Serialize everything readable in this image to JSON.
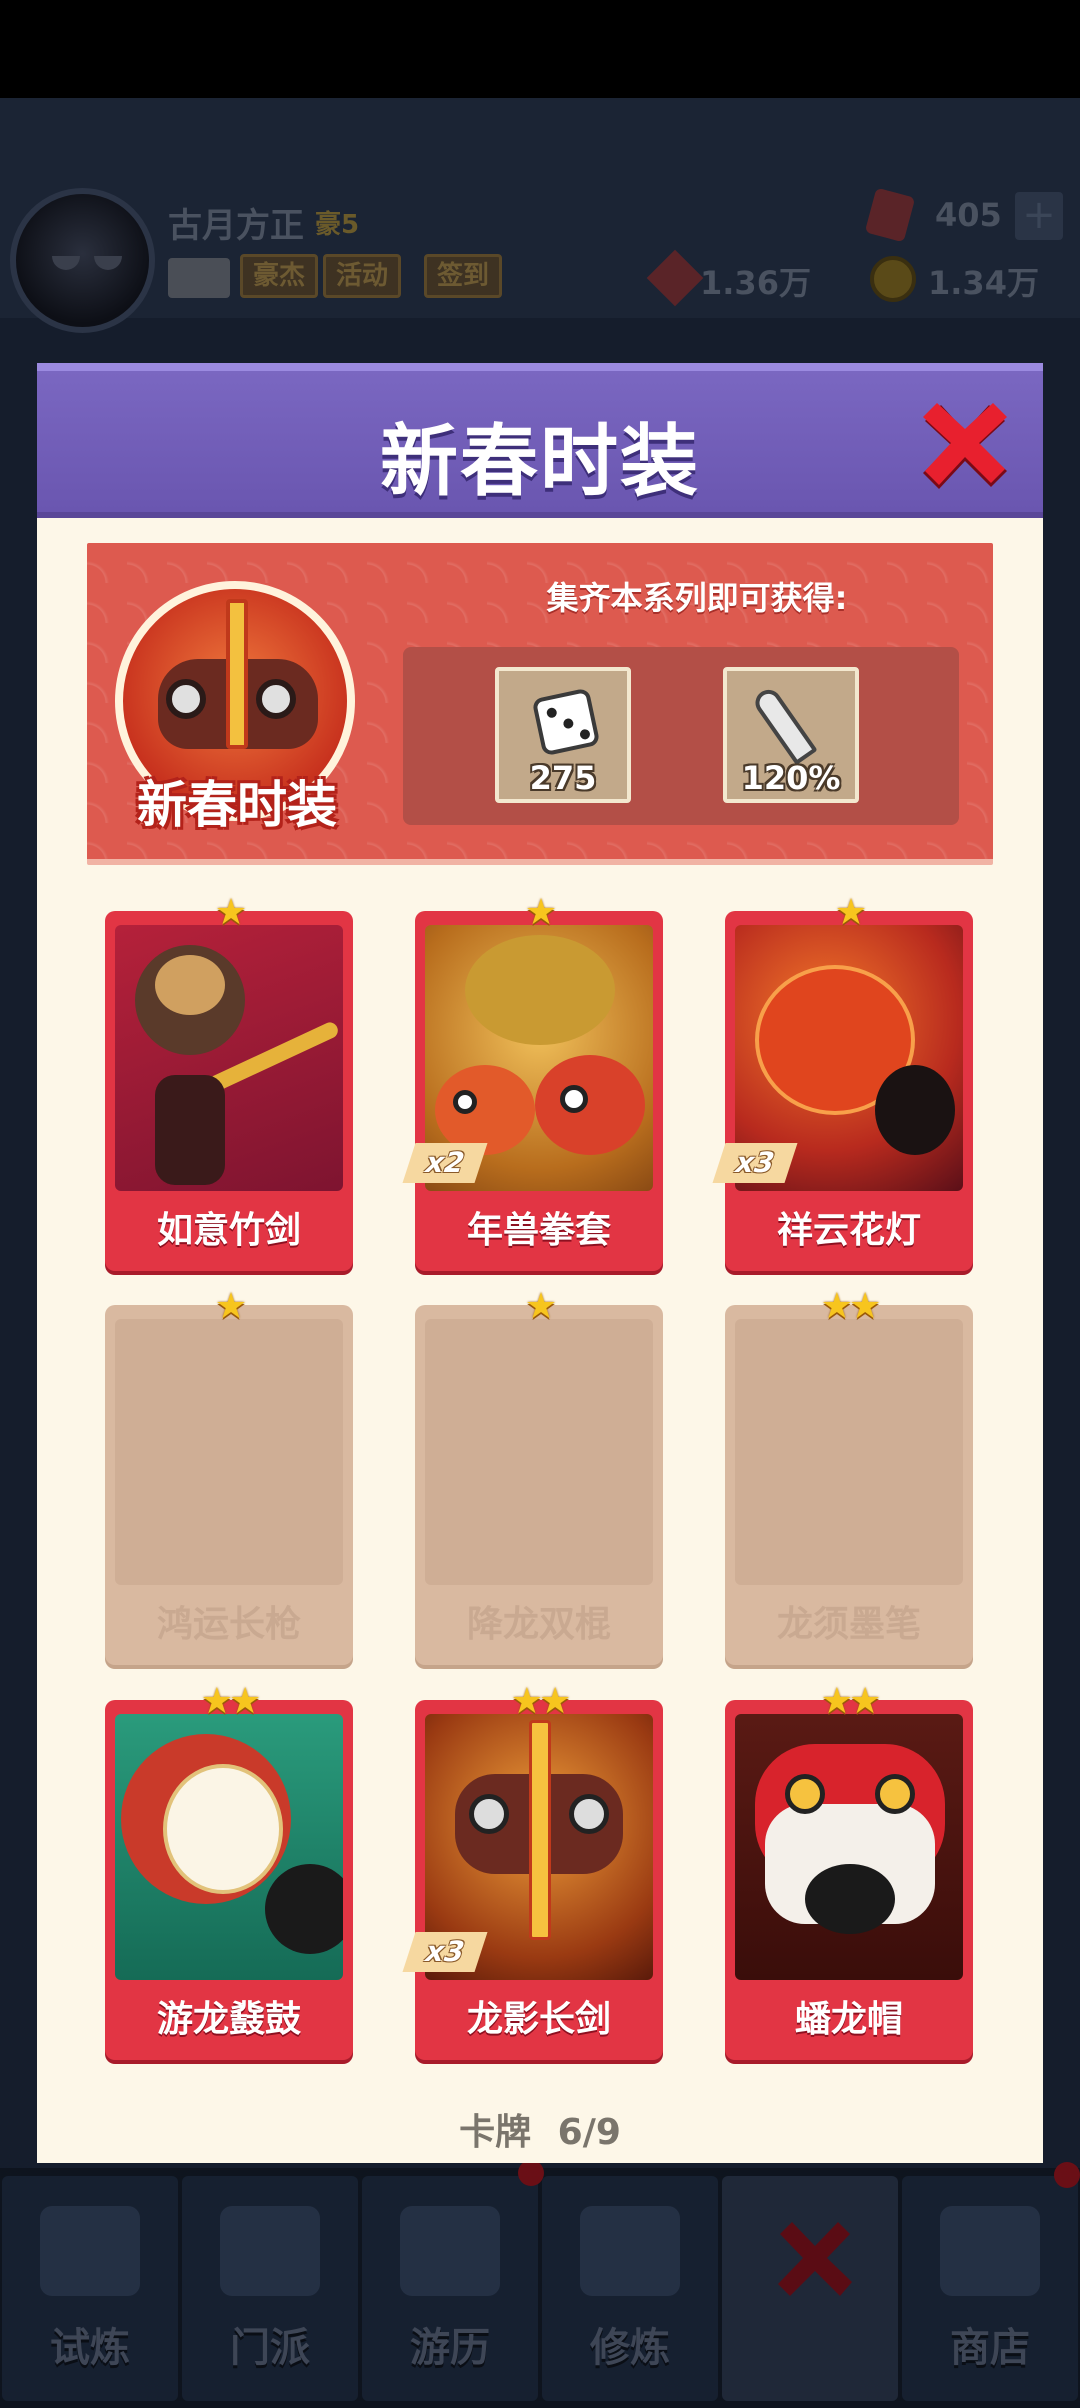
{
  "player": {
    "name": "古月方正",
    "rank": "豪5",
    "buttons": [
      "豪杰",
      "活动",
      "签到"
    ]
  },
  "currency": {
    "gems": "405",
    "tokens": "1.36万",
    "gold": "1.34万"
  },
  "modal": {
    "title": "新春时装",
    "banner": {
      "badge_label": "新春时装",
      "reward_title": "集齐本系列即可获得:",
      "rewards": [
        {
          "icon": "dice-icon",
          "label": "275"
        },
        {
          "icon": "knife-icon",
          "label": "120%"
        }
      ]
    },
    "cards": [
      {
        "name": "如意竹剑",
        "stars": "★",
        "multiplier": "",
        "locked": false
      },
      {
        "name": "年兽拳套",
        "stars": "★",
        "multiplier": "x2",
        "locked": false
      },
      {
        "name": "祥云花灯",
        "stars": "★",
        "multiplier": "x3",
        "locked": false
      },
      {
        "name": "鸿运长枪",
        "stars": "★",
        "multiplier": "",
        "locked": true
      },
      {
        "name": "降龙双棍",
        "stars": "★",
        "multiplier": "",
        "locked": true
      },
      {
        "name": "龙须墨笔",
        "stars": "★★",
        "multiplier": "",
        "locked": true
      },
      {
        "name": "游龙鼗鼓",
        "stars": "★★",
        "multiplier": "",
        "locked": false
      },
      {
        "name": "龙影长剑",
        "stars": "★★",
        "multiplier": "x3",
        "locked": false
      },
      {
        "name": "蟠龙帽",
        "stars": "★★",
        "multiplier": "",
        "locked": false
      }
    ],
    "pager_label": "卡牌",
    "pager_value": "6/9"
  },
  "bottom_nav": [
    {
      "label": "试炼"
    },
    {
      "label": "门派"
    },
    {
      "label": "游历"
    },
    {
      "label": "修炼"
    },
    {
      "label": ""
    },
    {
      "label": "商店"
    }
  ],
  "colors": {
    "header_purple": "#6a56b0",
    "card_red": "#e23544",
    "star_gold": "#f7c51e",
    "panel_cream": "#fdf7e8"
  }
}
